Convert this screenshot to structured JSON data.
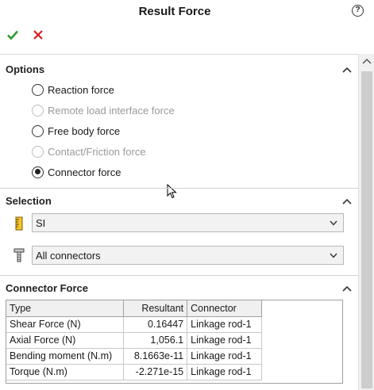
{
  "header": {
    "title": "Result Force",
    "help_icon": "help-icon"
  },
  "actions": {
    "ok_icon": "check-icon",
    "cancel_icon": "close-icon",
    "ok_color": "#2e9b32",
    "cancel_color": "#d32020"
  },
  "options": {
    "title": "Options",
    "radios": [
      {
        "label": "Reaction force",
        "checked": false,
        "disabled": false
      },
      {
        "label": "Remote load interface force",
        "checked": false,
        "disabled": true
      },
      {
        "label": "Free body force",
        "checked": false,
        "disabled": false
      },
      {
        "label": "Contact/Friction force",
        "checked": false,
        "disabled": true
      },
      {
        "label": "Connector force",
        "checked": true,
        "disabled": false
      }
    ]
  },
  "selection": {
    "title": "Selection",
    "units_value": "SI",
    "connectors_value": "All connectors",
    "units_icon": "ruler-icon",
    "connector_icon": "bolt-icon"
  },
  "connector_force": {
    "title": "Connector Force",
    "columns": [
      "Type",
      "Resultant",
      "Connector"
    ],
    "rows": [
      [
        "Shear Force (N)",
        "0.16447",
        "Linkage rod-1"
      ],
      [
        "Axial Force (N)",
        "1,056.1",
        "Linkage rod-1"
      ],
      [
        "Bending moment (N.m)",
        "8.1663e-11",
        "Linkage rod-1"
      ],
      [
        "Torque (N.m)",
        "-2.271e-15",
        "Linkage rod-1"
      ]
    ]
  }
}
